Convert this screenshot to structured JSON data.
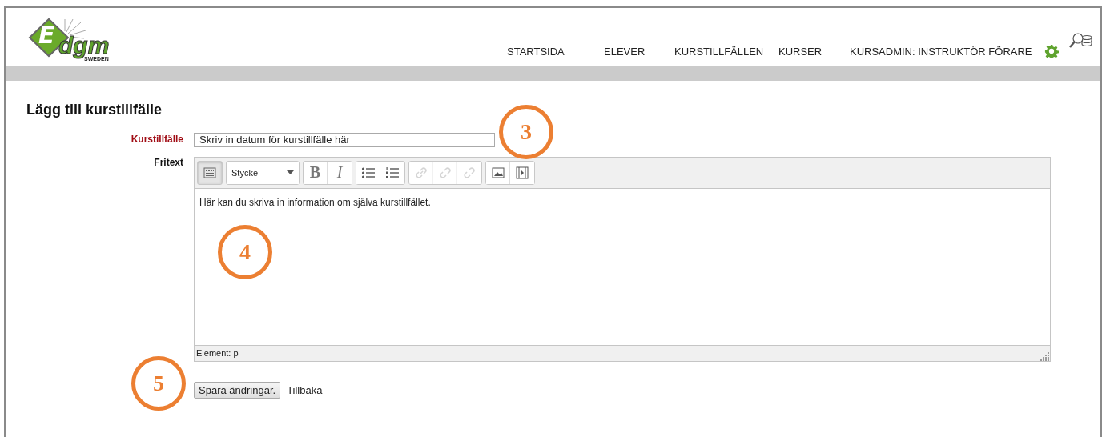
{
  "logo": {
    "letter": "E",
    "name": "dgm",
    "sub": "SWEDEN"
  },
  "nav": [
    {
      "label": "STARTSIDA"
    },
    {
      "label": "ELEVER"
    },
    {
      "label": "KURSTILLFÄLLEN"
    },
    {
      "label": "KURSER"
    },
    {
      "label": "KURSADMIN: INSTRUKTÖR FÖRARE"
    }
  ],
  "heading": "Lägg till kurstillfälle",
  "course_field": {
    "label": "Kurstillfälle",
    "required": true,
    "value": "Skriv in datum för kurstillfälle här"
  },
  "fritext": {
    "label": "Fritext",
    "toolbar": [
      [
        {
          "kind": "toggle",
          "disabled": false
        }
      ],
      [
        {
          "kind": "format",
          "text": "Stycke",
          "disabled": false
        }
      ],
      [
        {
          "kind": "bold",
          "text": "B",
          "disabled": false
        },
        {
          "kind": "italic",
          "text": "I",
          "disabled": false
        }
      ],
      [
        {
          "kind": "bullets",
          "disabled": false
        },
        {
          "kind": "numbers",
          "disabled": false
        }
      ],
      [
        {
          "kind": "link",
          "disabled": true
        },
        {
          "kind": "unlink",
          "disabled": true
        },
        {
          "kind": "anchor",
          "disabled": true
        }
      ],
      [
        {
          "kind": "image",
          "disabled": false
        },
        {
          "kind": "media",
          "disabled": false
        }
      ]
    ],
    "content": "Här kan du skriva in information om själva kurstillfället.",
    "status": "Element: p"
  },
  "actions": {
    "save": "Spara ändringar.",
    "back": "Tillbaka"
  },
  "callouts": [
    {
      "number": "3"
    },
    {
      "number": "4"
    },
    {
      "number": "5"
    }
  ]
}
